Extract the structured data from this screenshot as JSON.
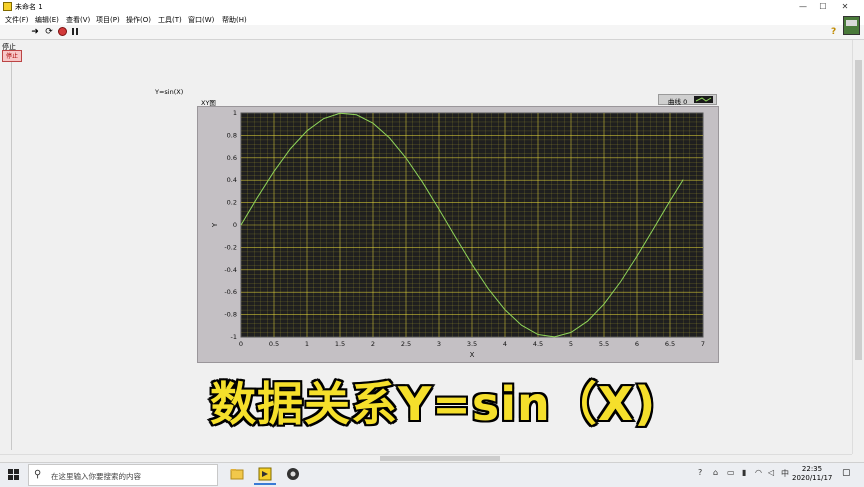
{
  "window": {
    "title": "未命名 1",
    "controls": [
      "—",
      "☐",
      "✕"
    ]
  },
  "menu": [
    "文件(F)",
    "编辑(E)",
    "查看(V)",
    "项目(P)",
    "操作(O)",
    "工具(T)",
    "窗口(W)",
    "帮助(H)"
  ],
  "toolbar": {
    "icons": [
      "run-arrow-icon",
      "run-continuously-icon",
      "abort-icon",
      "pause-icon"
    ],
    "help_glyph": "?"
  },
  "front_panel": {
    "stop_label": "停止",
    "stop_button": "停止",
    "function_label": "Y=sin(X)",
    "graph_label": "XY图",
    "legend_name": "曲线 0"
  },
  "chart_data": {
    "type": "line",
    "xlabel": "X",
    "ylabel": "Y",
    "xlim": [
      0,
      7
    ],
    "ylim": [
      -1,
      1
    ],
    "x_ticks": [
      "0",
      "0.5",
      "1",
      "1.5",
      "2",
      "2.5",
      "3",
      "3.5",
      "4",
      "4.5",
      "5",
      "5.5",
      "6",
      "6.5",
      "7"
    ],
    "y_ticks": [
      "1",
      "0.8",
      "0.6",
      "0.4",
      "0.2",
      "0",
      "-0.2",
      "-0.4",
      "-0.6",
      "-0.8",
      "-1"
    ],
    "grid": true,
    "plot_background": "#1f1f1f",
    "grid_color": "#e6d83a",
    "line_color": "#8fd45a",
    "series": [
      {
        "x": [
          0,
          0.25,
          0.5,
          0.75,
          1.0,
          1.25,
          1.5,
          1.75,
          2.0,
          2.25,
          2.5,
          2.75,
          3.0,
          3.25,
          3.5,
          3.75,
          4.0,
          4.25,
          4.5,
          4.75,
          5.0,
          5.25,
          5.5,
          5.75,
          6.0,
          6.25,
          6.5,
          6.7
        ],
        "y": [
          0,
          0.247,
          0.479,
          0.682,
          0.841,
          0.949,
          0.997,
          0.984,
          0.909,
          0.778,
          0.598,
          0.382,
          0.141,
          -0.108,
          -0.351,
          -0.572,
          -0.757,
          -0.895,
          -0.978,
          -0.999,
          -0.959,
          -0.859,
          -0.706,
          -0.508,
          -0.279,
          -0.033,
          0.215,
          0.405
        ]
      }
    ]
  },
  "caption": "数据关系Y=sin（X)",
  "taskbar": {
    "search_placeholder": "在这里输入你要搜索的内容",
    "tray_lang": "中",
    "time": "22:35",
    "date": "2020/11/17"
  }
}
